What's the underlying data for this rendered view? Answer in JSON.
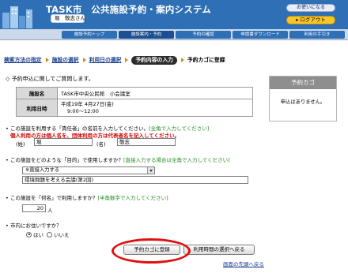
{
  "header": {
    "system_title": "TASK市　公共施設予約・案内システム",
    "user_name": "堀　敬志さん",
    "help_label": "お使いになる",
    "logout_label": "▸ ログアウト",
    "brand_color": "#2e6fb6"
  },
  "nav": {
    "tabs": [
      {
        "label": "施設予約トップ"
      },
      {
        "label": "施設案内・予約"
      },
      {
        "label": "予約の確認"
      },
      {
        "label": "申請書ダウンロード"
      },
      {
        "label": "利用の手引き"
      }
    ]
  },
  "breadcrumb": {
    "steps": [
      "検索方法の指定",
      "施設の選択",
      "利用日の選択"
    ],
    "current": "予約内容の入力",
    "next": "予約カゴに登録"
  },
  "section": {
    "heading": "予約申込に関してご質問します。"
  },
  "info": {
    "facility_label": "施設名",
    "facility_value": "TASK市中央公民館　小会議室",
    "datetime_label": "利用日時",
    "date_value": "平成19年 4月27日(金)",
    "time_value": "9:00～12:00"
  },
  "cart": {
    "title": "予約カゴ",
    "empty_message": "申込はありません。"
  },
  "q1": {
    "text": "この施設を利用する「責任者」の名前を入力してください。",
    "hint": "[全角で入力してください]",
    "warning": "個人利用の方は個人名を、団体利用の方は代表者名を記入してください。",
    "last_label": "(姓)",
    "last_value": "堀",
    "first_label": "(名)",
    "first_value": "敬志"
  },
  "q2": {
    "text": "この施設をどのような「目的」で使用しますか？",
    "hint": "[直接入力する場合は全角で入力してください]",
    "select_value": "※直接入力する",
    "purpose_value": "環境問題を考える会議(第2回)"
  },
  "q3": {
    "text": "この施設を「何名」で利用しますか？",
    "hint": "[半角数字で入力してください]",
    "count_value": "20",
    "unit": "人"
  },
  "q4": {
    "text": "市内にお住いですか？",
    "options": [
      "はい",
      "いいえ"
    ],
    "selected": "はい"
  },
  "actions": {
    "add_to_cart": "予約カゴに登録",
    "back_to_time": "利用時間の選択へ戻る",
    "top_link": "画面の先頭へ戻る",
    "highlight_color": "#e01010"
  }
}
